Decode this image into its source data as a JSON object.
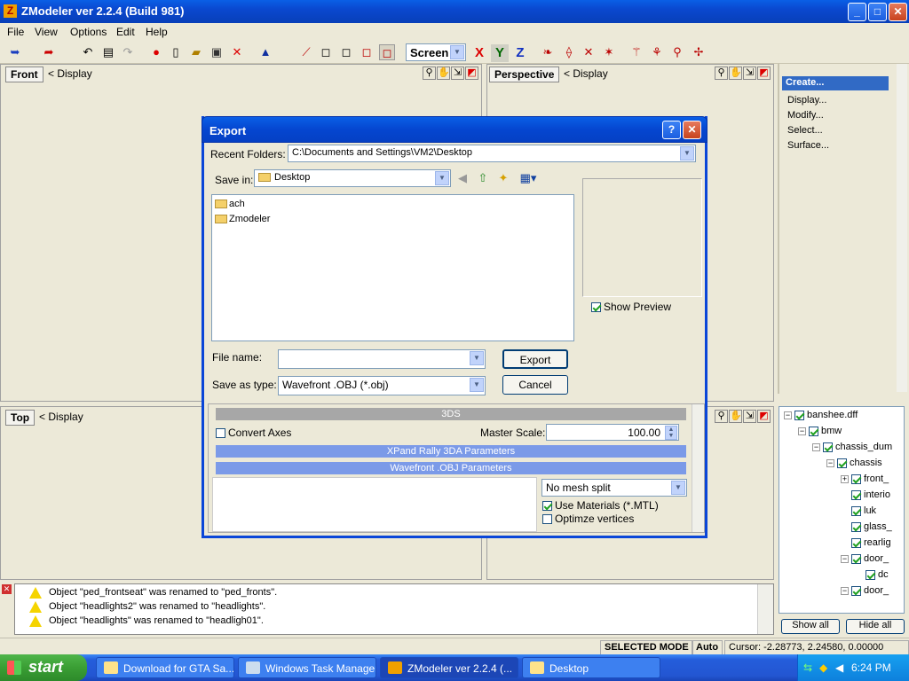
{
  "window": {
    "title": "ZModeler ver 2.2.4 (Build 981)",
    "min": "_",
    "max": "□",
    "close": "✕"
  },
  "menu": [
    "File",
    "View",
    "Options",
    "Edit",
    "Help"
  ],
  "toolbar": {
    "screen_value": "Screen",
    "axes": [
      "X",
      "Y",
      "Z"
    ]
  },
  "viewports": {
    "front": {
      "label": "Front",
      "display": "< Display"
    },
    "perspective": {
      "label": "Perspective",
      "display": "< Display"
    },
    "top": {
      "label": "Top",
      "display": "< Display"
    }
  },
  "right_panel": {
    "create": "Create...",
    "items": [
      "Display...",
      "Modify...",
      "Select...",
      "Surface..."
    ]
  },
  "tree": [
    {
      "label": "banshee.dff",
      "indent": 0,
      "exp": "−"
    },
    {
      "label": "bmw",
      "indent": 1,
      "exp": "−"
    },
    {
      "label": "chassis_dum",
      "indent": 2,
      "exp": "−"
    },
    {
      "label": "chassis",
      "indent": 3,
      "exp": "−"
    },
    {
      "label": "front_",
      "indent": 4,
      "exp": "+"
    },
    {
      "label": "interio",
      "indent": 4,
      "exp": ""
    },
    {
      "label": "luk",
      "indent": 4,
      "exp": ""
    },
    {
      "label": "glass_",
      "indent": 4,
      "exp": ""
    },
    {
      "label": "rearlig",
      "indent": 4,
      "exp": ""
    },
    {
      "label": "door_",
      "indent": 4,
      "exp": "−"
    },
    {
      "label": "dc",
      "indent": 5,
      "exp": ""
    },
    {
      "label": "door_",
      "indent": 4,
      "exp": "−"
    }
  ],
  "tree_buttons": {
    "show_all": "Show all",
    "hide_all": "Hide all"
  },
  "log": [
    "Object \"ped_frontseat\" was renamed to \"ped_fronts\".",
    "Object \"headlights2\" was renamed to \"headlights\".",
    "Object \"headlights\" was renamed to \"headligh01\"."
  ],
  "status": {
    "mode": "SELECTED MODE",
    "auto": "Auto",
    "cursor": "Cursor: -2.28773, 2.24580, 0.00000"
  },
  "dialog": {
    "title": "Export",
    "help": "?",
    "close": "✕",
    "recent_label": "Recent Folders:",
    "recent_value": "C:\\Documents and Settings\\VM2\\Desktop",
    "save_in_label": "Save in:",
    "save_in_value": "Desktop",
    "files": [
      "ach",
      "Zmodeler"
    ],
    "show_preview": "Show Preview",
    "filename_label": "File name:",
    "filename_value": "",
    "type_label": "Save as type:",
    "type_value": "Wavefront .OBJ (*.obj)",
    "export_btn": "Export",
    "cancel_btn": "Cancel",
    "sec_3ds": "3DS",
    "convert_axes": "Convert Axes",
    "master_scale_label": "Master Scale:",
    "master_scale_value": "100.00",
    "sec_xpand": "XPand Rally 3DA Parameters",
    "sec_obj": "Wavefront .OBJ Parameters",
    "mesh_split": "No mesh split",
    "use_materials": "Use Materials (*.MTL)",
    "optimize": "Optimze vertices"
  },
  "taskbar": {
    "start": "start",
    "tasks": [
      "Download for GTA Sa...",
      "Windows Task Manager",
      "ZModeler ver 2.2.4 (...",
      "Desktop"
    ],
    "clock": "6:24 PM"
  }
}
